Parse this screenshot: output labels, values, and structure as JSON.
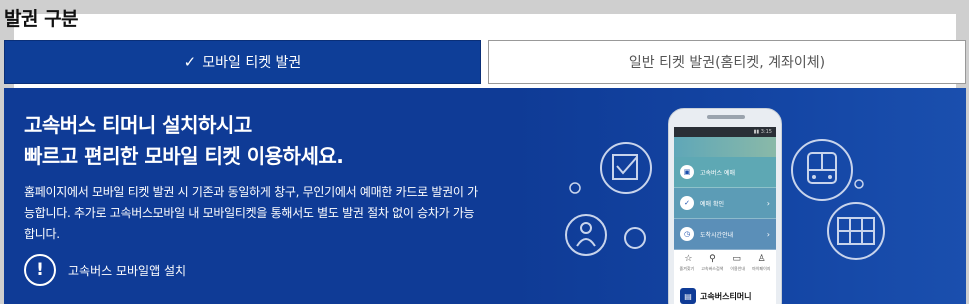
{
  "section": {
    "title": "발권 구분"
  },
  "tabs": {
    "mobile": {
      "check_icon": "check-icon",
      "label": "모바일 티켓 발권"
    },
    "general": {
      "label": "일반 티켓 발권(홈티켓, 계좌이체)"
    }
  },
  "banner": {
    "headline_line1": "고속버스 티머니 설치하시고",
    "headline_line2": "빠르고 편리한 모바일 티켓 이용하세요.",
    "description_line1": "홈페이지에서 모바일 티켓 발권 시 기존과 동일하게 창구, 무인기에서 예매한 카드로 발권이 가",
    "description_line2": "능합니다. 추가로 고속버스모바일 내 모바일티켓을 통해서도 별도 발권 절차 없이 승차가 가능",
    "description_line3": "합니다.",
    "install_label": "고속버스 모바일앱 설치"
  },
  "phone": {
    "status_text": "▮▮ 3:15",
    "menu": [
      {
        "label": "고속버스 예매",
        "icon": "bus-icon"
      },
      {
        "label": "예매 확인",
        "icon": "check-icon"
      },
      {
        "label": "도착시간안내",
        "icon": "clock-icon"
      }
    ],
    "bottom_nav": [
      "즐겨찾기",
      "고속버스검색",
      "이용안내",
      "마이페이지"
    ],
    "app_name": "고속버스티머니"
  },
  "colors": {
    "primary": "#0e3e98",
    "banner_bg": "#0f3b96",
    "tab_inactive_border": "#999999",
    "page_bg": "#cfcfcf"
  }
}
